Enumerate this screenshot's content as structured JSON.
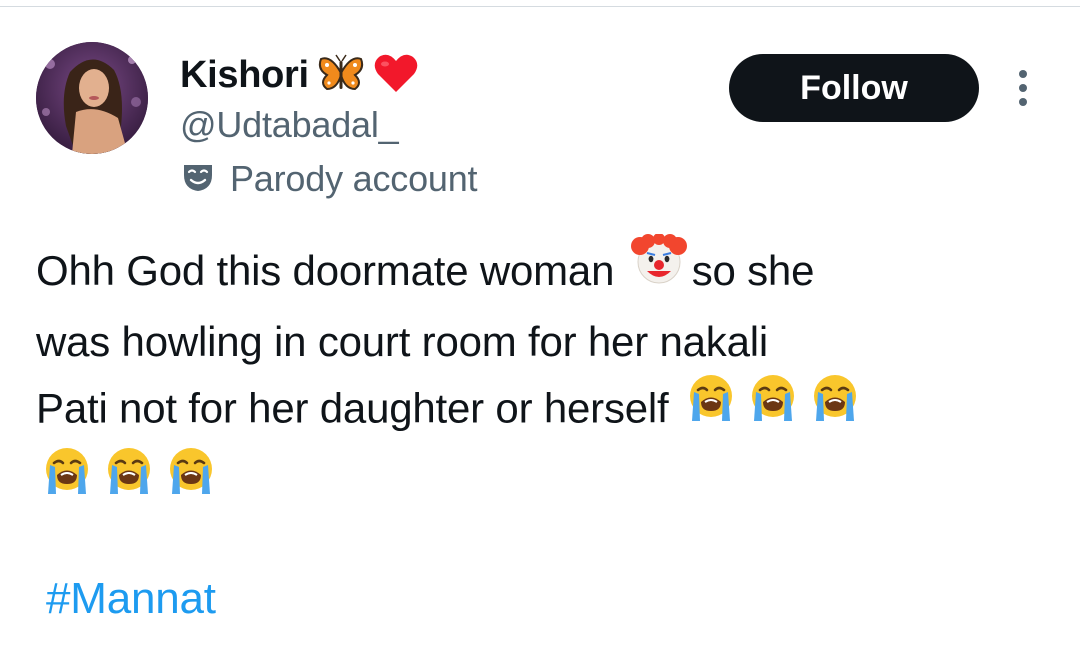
{
  "tweet": {
    "author": {
      "display_name": "Kishori",
      "display_name_emojis": [
        "butterfly-emoji",
        "red-heart-emoji"
      ],
      "handle": "@Udtabadal_",
      "label": "Parody account",
      "label_icon": "parody-mask-icon"
    },
    "follow_label": "Follow",
    "more_icon": "more-vertical-icon",
    "text": {
      "line1_a": "Ohh God this doormate woman ",
      "line1_emoji": "clown-face-emoji",
      "line1_b": "so she",
      "line2": "was howling in court room for her nakali",
      "line3": "Pati not for her daughter or herself ",
      "crying_emoji": "loudly-crying-face-emoji"
    },
    "hashtag": "#Mannat"
  },
  "colors": {
    "text_primary": "#0f1419",
    "text_secondary": "#536471",
    "link": "#1d9bf0",
    "button_bg": "#0f1419",
    "button_text": "#ffffff"
  }
}
